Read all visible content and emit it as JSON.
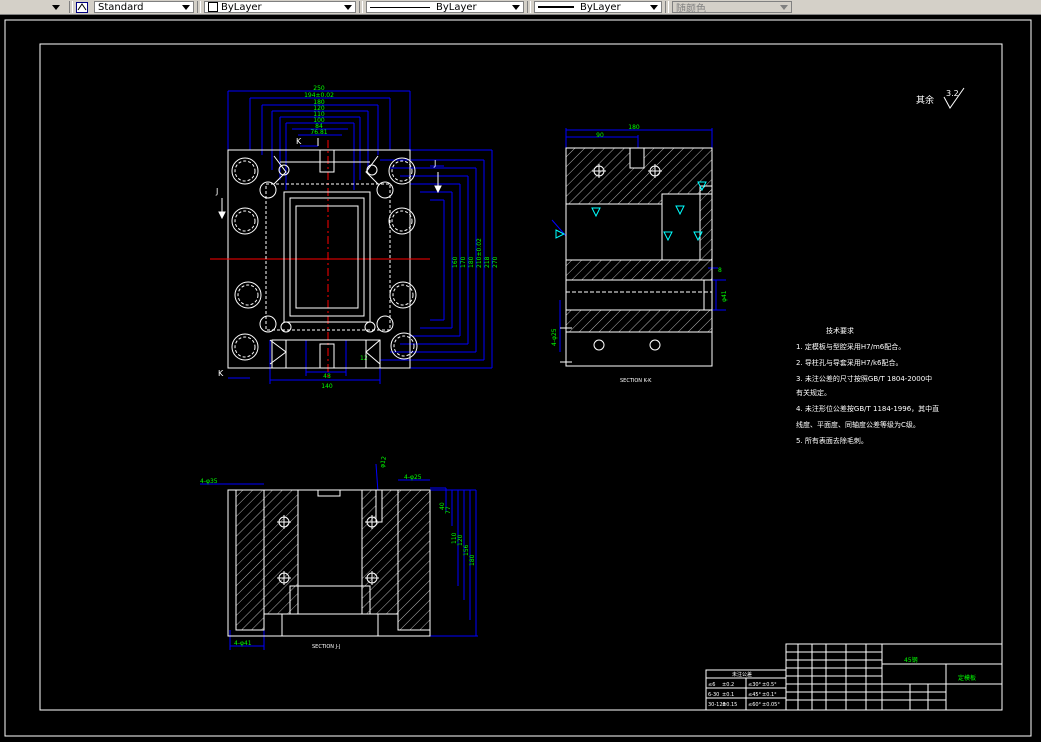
{
  "toolbar": {
    "text_style": "Standard",
    "layer": "ByLayer",
    "linetype": "ByLayer",
    "lineweight": "ByLayer",
    "plot_style": "随颜色"
  },
  "drawing": {
    "roughness_note": "其余",
    "roughness_value": "3.2",
    "plan_dims": [
      "250",
      "194±0.02",
      "180",
      "120",
      "110",
      "100",
      "84",
      "76.81"
    ],
    "plan_side_dims": [
      "160",
      "170",
      "180",
      "210±0.02",
      "218",
      "270"
    ],
    "bottom_dims": [
      "48",
      "140"
    ],
    "plan_labels": {
      "k": "K",
      "j": "J",
      "r": "12"
    },
    "section_k_dims": {
      "top": "180",
      "left": "90",
      "right_dim": "8",
      "phi": "φ41",
      "hole": "4-φ25"
    },
    "section_k_title": "SECTION K-K",
    "section_j_title": "SECTION J-J",
    "section_j_dims": {
      "top_left": "4-φ35",
      "top_mid": "φ12",
      "top_right": "4-φ25",
      "bottom": "4-φ41",
      "right": [
        "40",
        "77",
        "110",
        "120",
        "156",
        "180"
      ]
    },
    "tech_title": "技术要求",
    "tech_notes": [
      "1. 定模板与型腔采用H7/m6配合。",
      "2. 导柱孔与导套采用H7/k6配合。",
      "3. 未注公差的尺寸按照GB/T 1804-2000中",
      "   有关规定。",
      "4. 未注形位公差按GB/T 1184-1996，其中直",
      "   线度、平面度、同轴度公差等级为C级。",
      "5. 所有表面去除毛刺。"
    ],
    "title_block": {
      "part_name": "定模板",
      "material": "45钢",
      "tol_header": "未注公差"
    },
    "tol_table": {
      "header": "未注公差",
      "rows": [
        [
          "≤6",
          "±0.2",
          "≤30°",
          "±0.5°"
        ],
        [
          "6-30",
          "±0.1",
          "≤45°",
          "±0.1°"
        ],
        [
          "30-120",
          "±0.15",
          "≤60°",
          "±0.05°"
        ]
      ]
    }
  },
  "colors": {
    "background": "#000000",
    "frame": "#ffffff",
    "dimension": "#0000ff",
    "annotation": "#00ff00",
    "centerline": "#ff0000",
    "outline": "#ffffff",
    "toolbar": "#d4d0c8"
  }
}
